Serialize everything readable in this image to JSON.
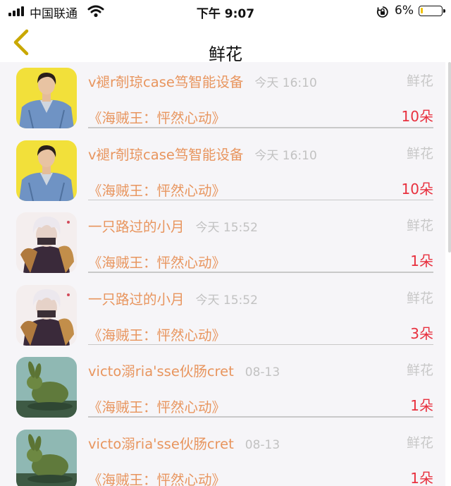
{
  "status": {
    "carrier": "中国联通",
    "time": "下午 9:07",
    "battery": "6%",
    "battery_level": 0.06
  },
  "nav": {
    "title": "鲜花",
    "back_icon": "chevron-left-icon"
  },
  "items": [
    {
      "name": "v褪r剞琼case笃智能设备",
      "time": "今天 16:10",
      "gift": "鲜花",
      "work": "《海贼王：怦然心动》",
      "count": "10朵",
      "avatar": "avatar-man-denim-jacket"
    },
    {
      "name": "v褪r剞琼case笃智能设备",
      "time": "今天 16:10",
      "gift": "鲜花",
      "work": "《海贼王：怦然心动》",
      "count": "10朵",
      "avatar": "avatar-man-denim-jacket"
    },
    {
      "name": "一只路过的小月",
      "time": "今天 15:52",
      "gift": "鲜花",
      "work": "《海贼王：怦然心动》",
      "count": "1朵",
      "avatar": "avatar-anime-white-hair"
    },
    {
      "name": "一只路过的小月",
      "time": "今天 15:52",
      "gift": "鲜花",
      "work": "《海贼王：怦然心动》",
      "count": "3朵",
      "avatar": "avatar-anime-white-hair"
    },
    {
      "name": "victo溺ria'sse伙肠cret",
      "time": "08-13",
      "gift": "鲜花",
      "work": "《海贼王：怦然心动》",
      "count": "1朵",
      "avatar": "avatar-jade-rabbit"
    },
    {
      "name": "victo溺ria'sse伙肠cret",
      "time": "08-13",
      "gift": "鲜花",
      "work": "《海贼王：怦然心动》",
      "count": "1朵",
      "avatar": "avatar-jade-rabbit"
    }
  ],
  "colors": {
    "accent_orange": "#e8955e",
    "count_red": "#e8303e",
    "muted_gray": "#c2c2c2",
    "list_bg": "#f6f5f8",
    "back_yellow": "#c9a800"
  }
}
